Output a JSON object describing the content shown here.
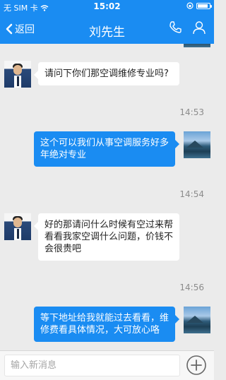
{
  "status_bar": {
    "carrier": "无 SIM 卡",
    "time": "15:02",
    "battery_level": 0.85
  },
  "nav": {
    "back_label": "返回",
    "title": "刘先生",
    "icons": [
      "phone-icon",
      "profile-icon"
    ]
  },
  "messages": [
    {
      "side": "in",
      "text": "请问下你们那空调维修专业吗?"
    },
    {
      "time": "14:53"
    },
    {
      "side": "out",
      "text": "这个可以我们从事空调服务好多年绝对专业"
    },
    {
      "time": "14:54"
    },
    {
      "side": "in",
      "text": "好的那请问什么时候有空过来帮看看我家空调什么问题，价钱不会很贵吧"
    },
    {
      "time": "14:56"
    },
    {
      "side": "out",
      "text": "等下地址给我就能过去看看，维修费看具体情况，大可放心咯"
    }
  ],
  "composer": {
    "placeholder": "输入新消息",
    "add_icon": "plus-circle-icon"
  },
  "colors": {
    "accent": "#1a8cf2",
    "background": "#ebebeb",
    "timestamp": "#8c8c8c"
  }
}
